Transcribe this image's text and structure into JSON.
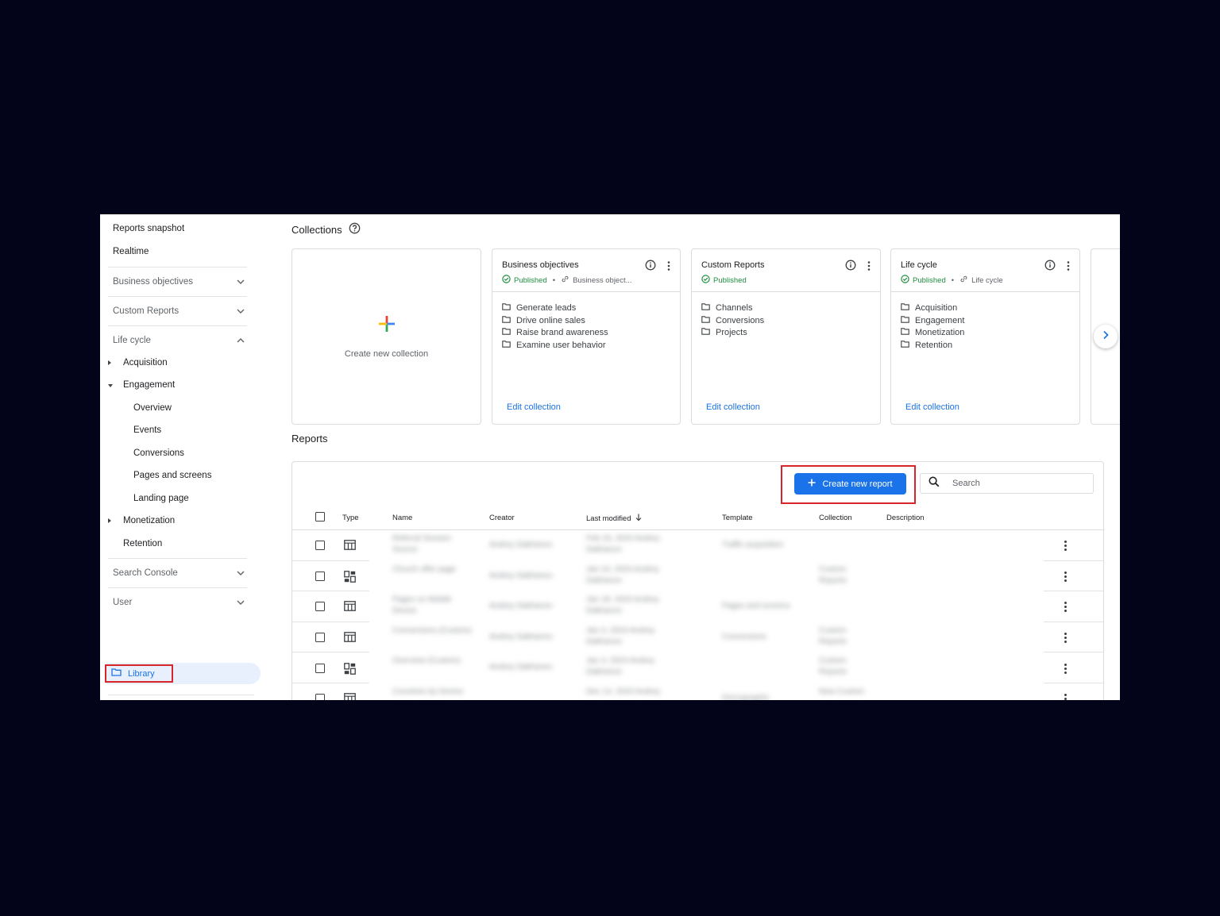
{
  "sidebar": {
    "top_items": [
      "Reports snapshot",
      "Realtime"
    ],
    "sections": {
      "business_objectives": "Business objectives",
      "custom_reports": "Custom Reports",
      "life_cycle": "Life cycle",
      "search_console": "Search Console",
      "user": "User"
    },
    "life_cycle_items": {
      "acquisition": "Acquisition",
      "engagement": "Engagement",
      "monetization": "Monetization",
      "retention": "Retention"
    },
    "engagement_items": [
      "Overview",
      "Events",
      "Conversions",
      "Pages and screens",
      "Landing page"
    ],
    "library": "Library"
  },
  "collections": {
    "title": "Collections",
    "create_label": "Create new collection",
    "edit_label": "Edit collection",
    "cards": [
      {
        "title": "Business objectives",
        "status": "Published",
        "template": "Business object...",
        "folders": [
          "Generate leads",
          "Drive online sales",
          "Raise brand awareness",
          "Examine user behavior"
        ]
      },
      {
        "title": "Custom Reports",
        "status": "Published",
        "template": "",
        "folders": [
          "Channels",
          "Conversions",
          "Projects"
        ]
      },
      {
        "title": "Life cycle",
        "status": "Published",
        "template": "Life cycle",
        "folders": [
          "Acquisition",
          "Engagement",
          "Monetization",
          "Retention"
        ]
      }
    ]
  },
  "reports": {
    "title": "Reports",
    "create_button": "Create new report",
    "search_placeholder": "Search",
    "columns": {
      "type": "Type",
      "name": "Name",
      "creator": "Creator",
      "last_modified": "Last modified",
      "template": "Template",
      "collection": "Collection",
      "description": "Description"
    },
    "rows": [
      {
        "type": "table",
        "name": "Referral Session Source",
        "creator": "Andrey Dakhanov",
        "modified": "Feb 19, 2024 Andrey Dakhanov",
        "template": "Traffic acquisition",
        "collection": ""
      },
      {
        "type": "dashboard",
        "name": "Church offer page",
        "creator": "Andrey Dakhanov",
        "modified": "Jan 24, 2024 Andrey Dakhanov",
        "template": "",
        "collection": "Custom Reports"
      },
      {
        "type": "table",
        "name": "Pages on Mobile Device",
        "creator": "Andrey Dakhanov",
        "modified": "Jan 18, 2024 Andrey Dakhanov",
        "template": "Pages and screens",
        "collection": ""
      },
      {
        "type": "table",
        "name": "Conversions (Custom)",
        "creator": "Andrey Dakhanov",
        "modified": "Jan 4, 2024 Andrey Dakhanov",
        "template": "Conversions",
        "collection": "Custom Reports"
      },
      {
        "type": "dashboard",
        "name": "Overview (Custom)",
        "creator": "Andrey Dakhanov",
        "modified": "Jan 4, 2024 Andrey Dakhanov",
        "template": "",
        "collection": "Custom Reports"
      },
      {
        "type": "table",
        "name": "Countries by Device",
        "creator": "",
        "modified": "Dec 14, 2023 Andrey",
        "template": "Demographic",
        "collection": "New Custom"
      }
    ]
  }
}
